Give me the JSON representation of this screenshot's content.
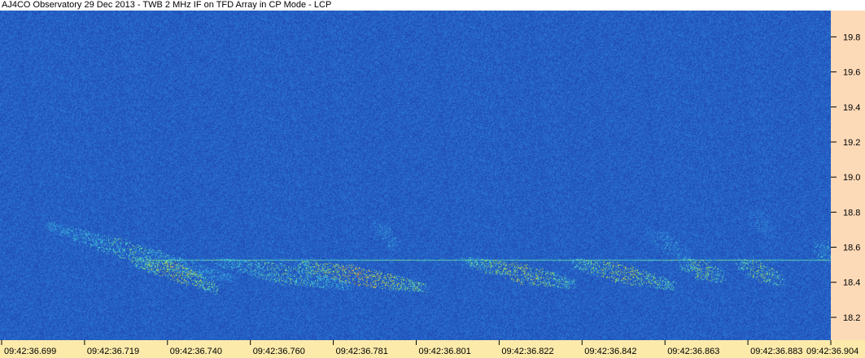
{
  "title": "AJ4CO Observatory 29 Dec 2013 - TWB 2 MHz IF on TFD Array in CP Mode - LCP",
  "colors": {
    "background_low": "#1c3fae",
    "y_axis_panel": "#fcd9b7",
    "x_axis_panel": "#fbeaaa",
    "text": "#000000"
  },
  "chart_data": {
    "type": "heatmap",
    "title": "AJ4CO Observatory 29 Dec 2013 - TWB 2 MHz IF on TFD Array in CP Mode - LCP",
    "xlabel": "",
    "ylabel": "",
    "x_ticks": [
      "09:42:36.699",
      "09:42:36.719",
      "09:42:36.740",
      "09:42:36.760",
      "09:42:36.781",
      "09:42:36.801",
      "09:42:36.822",
      "09:42:36.842",
      "09:42:36.863",
      "09:42:36.883",
      "09:42:36.904"
    ],
    "y_ticks": [
      "19.8",
      "19.6",
      "19.4",
      "19.2",
      "19.0",
      "18.8",
      "18.6",
      "18.4",
      "18.2"
    ],
    "y_tick_values": [
      19.8,
      19.6,
      19.4,
      19.2,
      19.0,
      18.8,
      18.6,
      18.4,
      18.2
    ],
    "ylim": [
      18.07,
      19.95
    ],
    "xlim": [
      0,
      10
    ],
    "colormap": [
      "#1c3fae",
      "#2d7fd8",
      "#3fd0d8",
      "#a8e04a",
      "#f0d040",
      "#e04a30"
    ],
    "carrier_line_mhz": 18.53,
    "emission_features": [
      {
        "x": [
          0.55,
          1.2,
          2.0,
          2.8
        ],
        "y": [
          18.73,
          18.63,
          18.52,
          18.42
        ],
        "intensity": 0.55
      },
      {
        "x": [
          1.6,
          2.1,
          2.6
        ],
        "y": [
          18.52,
          18.47,
          18.36
        ],
        "intensity": 0.85
      },
      {
        "x": [
          2.6,
          3.4,
          4.2
        ],
        "y": [
          18.52,
          18.45,
          18.38
        ],
        "intensity": 0.6
      },
      {
        "x": [
          3.6,
          4.3,
          5.1
        ],
        "y": [
          18.5,
          18.44,
          18.37
        ],
        "intensity": 0.95
      },
      {
        "x": [
          4.5,
          4.8
        ],
        "y": [
          18.73,
          18.6
        ],
        "intensity": 0.35
      },
      {
        "x": [
          5.6,
          6.3,
          6.9
        ],
        "y": [
          18.52,
          18.45,
          18.39
        ],
        "intensity": 0.8
      },
      {
        "x": [
          6.9,
          7.5,
          8.1
        ],
        "y": [
          18.51,
          18.45,
          18.38
        ],
        "intensity": 0.8
      },
      {
        "x": [
          7.8,
          8.3
        ],
        "y": [
          18.68,
          18.56
        ],
        "intensity": 0.35
      },
      {
        "x": [
          8.2,
          8.7
        ],
        "y": [
          18.51,
          18.43
        ],
        "intensity": 0.7
      },
      {
        "x": [
          8.9,
          9.4
        ],
        "y": [
          18.51,
          18.41
        ],
        "intensity": 0.7
      },
      {
        "x": [
          9.0,
          9.3
        ],
        "y": [
          18.8,
          18.68
        ],
        "intensity": 0.3
      },
      {
        "x": [
          9.8,
          10.0
        ],
        "y": [
          18.6,
          18.57
        ],
        "intensity": 0.45
      }
    ]
  }
}
